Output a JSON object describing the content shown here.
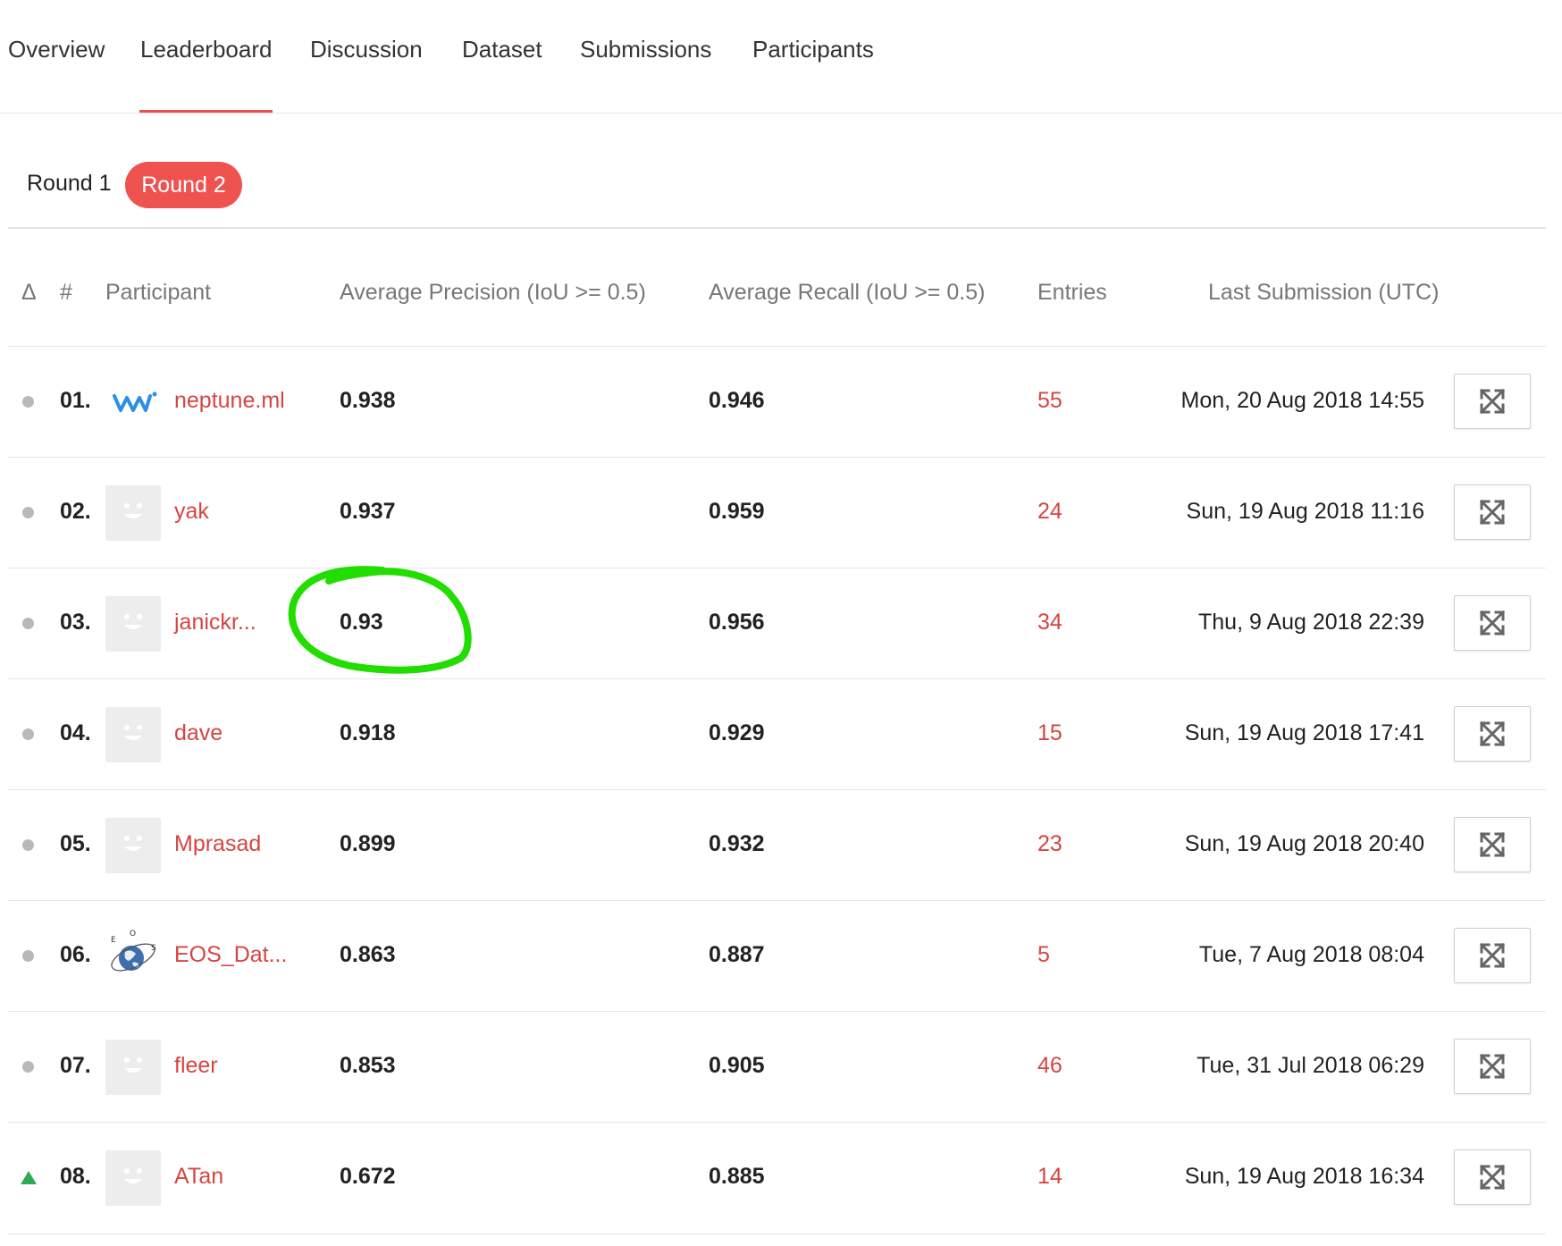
{
  "nav": {
    "tabs": [
      {
        "label": "Overview"
      },
      {
        "label": "Leaderboard"
      },
      {
        "label": "Discussion"
      },
      {
        "label": "Dataset"
      },
      {
        "label": "Submissions"
      },
      {
        "label": "Participants"
      }
    ],
    "active": "Leaderboard"
  },
  "rounds": {
    "round1": "Round 1",
    "round2": "Round 2",
    "active": "Round 2"
  },
  "table": {
    "headers": {
      "delta": "Δ",
      "rank": "#",
      "participant": "Participant",
      "precision": "Average Precision (IoU >= 0.5)",
      "recall": "Average Recall (IoU >= 0.5)",
      "entries": "Entries",
      "last_submission": "Last Submission (UTC)"
    },
    "rows": [
      {
        "delta": "none",
        "rank": "01.",
        "avatar": "neptune-logo-icon",
        "name": "neptune.ml",
        "precision": "0.938",
        "recall": "0.946",
        "entries": "55",
        "last": "Mon, 20 Aug 2018 14:55"
      },
      {
        "delta": "none",
        "rank": "02.",
        "avatar": "default-smiley-avatar",
        "name": "yak",
        "precision": "0.937",
        "recall": "0.959",
        "entries": "24",
        "last": "Sun, 19 Aug 2018 11:16"
      },
      {
        "delta": "none",
        "rank": "03.",
        "avatar": "default-smiley-avatar",
        "name": "janickr...",
        "precision": "0.93",
        "recall": "0.956",
        "entries": "34",
        "last": "Thu, 9 Aug 2018 22:39"
      },
      {
        "delta": "none",
        "rank": "04.",
        "avatar": "default-smiley-avatar",
        "name": "dave",
        "precision": "0.918",
        "recall": "0.929",
        "entries": "15",
        "last": "Sun, 19 Aug 2018 17:41"
      },
      {
        "delta": "none",
        "rank": "05.",
        "avatar": "default-smiley-avatar",
        "name": "Mprasad",
        "precision": "0.899",
        "recall": "0.932",
        "entries": "23",
        "last": "Sun, 19 Aug 2018 20:40"
      },
      {
        "delta": "none",
        "rank": "06.",
        "avatar": "eos-globe-logo-icon",
        "name": "EOS_Dat...",
        "precision": "0.863",
        "recall": "0.887",
        "entries": "5",
        "last": "Tue, 7 Aug 2018 08:04"
      },
      {
        "delta": "none",
        "rank": "07.",
        "avatar": "default-smiley-avatar",
        "name": "fleer",
        "precision": "0.853",
        "recall": "0.905",
        "entries": "46",
        "last": "Tue, 31 Jul 2018 06:29"
      },
      {
        "delta": "up",
        "rank": "08.",
        "avatar": "default-smiley-avatar",
        "name": "ATan",
        "precision": "0.672",
        "recall": "0.885",
        "entries": "14",
        "last": "Sun, 19 Aug 2018 16:34"
      }
    ]
  },
  "annotation": {
    "type": "hand-drawn-circle",
    "color": "#22dd00",
    "target": "rows.2.precision"
  },
  "colors": {
    "accent": "#ef5350",
    "link": "#d64541",
    "up": "#2eaa55"
  }
}
